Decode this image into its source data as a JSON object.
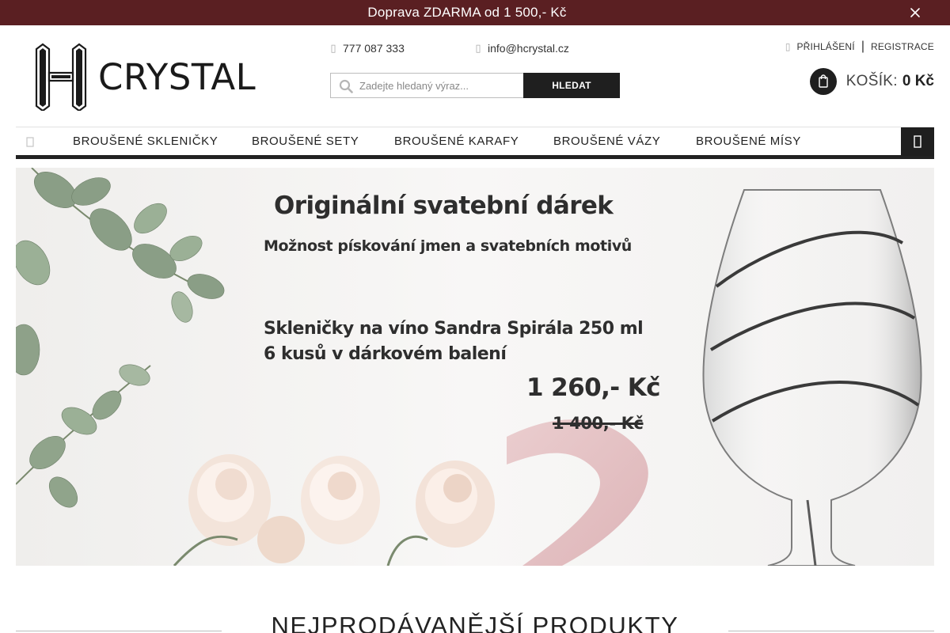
{
  "promo": {
    "text": "Doprava ZDARMA od 1 500,- Kč",
    "close_icon": "close-icon",
    "background": "#5a1f22"
  },
  "brand": {
    "logo_text": "CRYSTAL"
  },
  "contact": {
    "phone": "777 087 333",
    "email": "info@hcrystal.cz",
    "phone_icon": "phone-icon",
    "email_icon": "mail-icon"
  },
  "search": {
    "placeholder": "Zadejte hledaný výraz...",
    "value": "",
    "button_label": "HLEDAT"
  },
  "account": {
    "login_label": "PŘIHLÁŠENÍ",
    "separator": "|",
    "register_label": "REGISTRACE"
  },
  "cart": {
    "label": "KOŠÍK:",
    "total": "0 Kč"
  },
  "nav": {
    "home_icon": "home-icon",
    "items": [
      {
        "label": "BROUŠENÉ SKLENIČKY"
      },
      {
        "label": "BROUŠENÉ SETY"
      },
      {
        "label": "BROUŠENÉ KARAFY"
      },
      {
        "label": "BROUŠENÉ VÁZY"
      },
      {
        "label": "BROUŠENÉ MÍSY"
      }
    ],
    "more_icon": "menu-icon"
  },
  "banner": {
    "title": "Originální svatební dárek",
    "subtitle": "Možnost pískování jmen a svatebních motivů",
    "line1": "Skleničky na víno Sandra Spirála 250 ml",
    "line2": "6 kusů v dárkovém balení",
    "price": "1 260,- Kč",
    "old_price": "1 400,- Kč"
  },
  "section": {
    "title": "NEJPRODÁVANĚJŠÍ PRODUKTY"
  }
}
